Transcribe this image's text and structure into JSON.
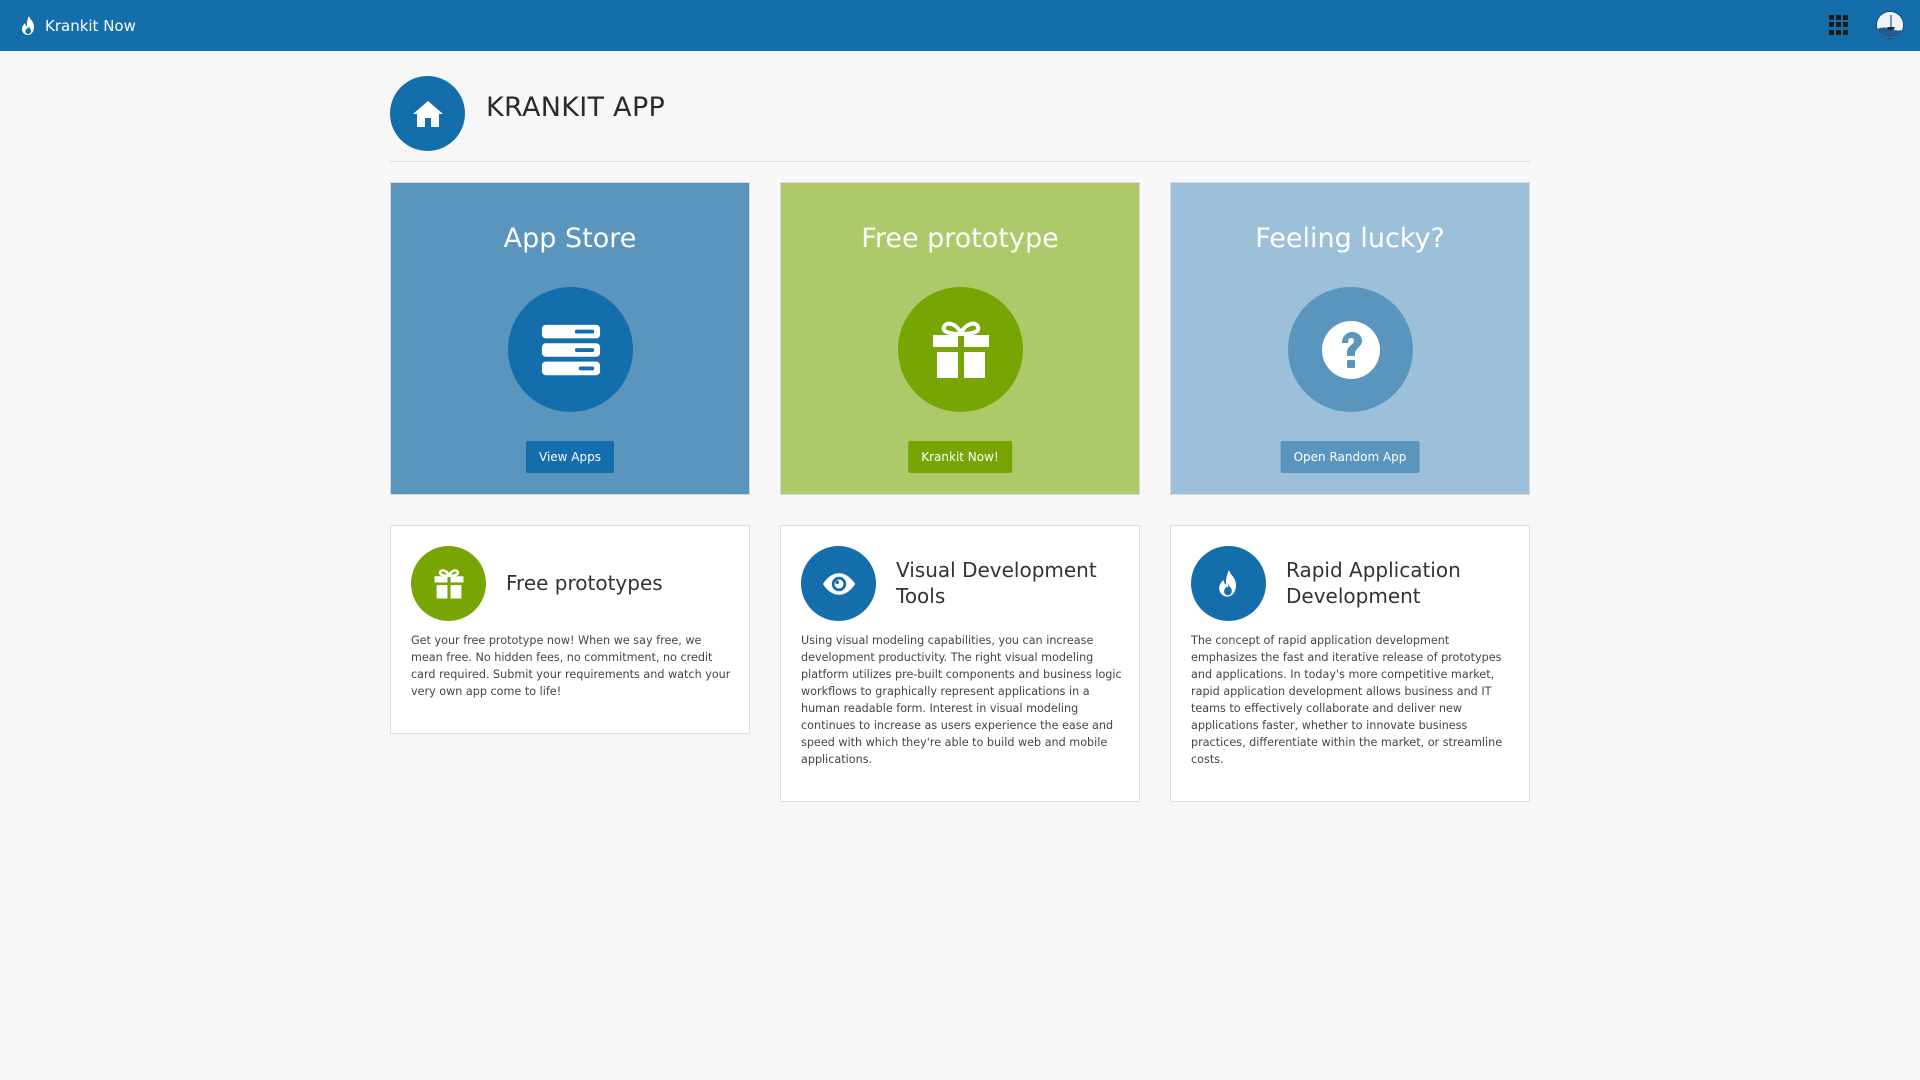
{
  "navbar": {
    "brand_label": "Krankit Now",
    "apps_icon": "apps-grid-icon",
    "avatar_icon": "user-avatar",
    "bg_color": "#146eac"
  },
  "header": {
    "title": "KRANKIT APP",
    "icon": "home-icon"
  },
  "hero_cards": [
    {
      "title": "App Store",
      "icon": "server-stack-icon",
      "button_label": "View Apps",
      "bg_color": "#5a95be",
      "accent_color": "#146eac"
    },
    {
      "title": "Free prototype",
      "icon": "gift-icon",
      "button_label": "Krankit Now!",
      "bg_color": "#aec96a",
      "accent_color": "#77a503"
    },
    {
      "title": "Feeling lucky?",
      "icon": "question-icon",
      "button_label": "Open Random App",
      "bg_color": "#9dc0da",
      "accent_color": "#5a95be"
    }
  ],
  "info_cards": [
    {
      "title": "Free prototypes",
      "icon": "gift-icon",
      "text": "Get your free prototype now! When we say free, we mean free. No hidden fees, no commitment, no credit card required. Submit your requirements and watch your very own app come to life!"
    },
    {
      "title": "Visual Development Tools",
      "icon": "eye-icon",
      "text": "Using visual modeling capabilities, you can increase development productivity. The right visual modeling platform utilizes pre-built components and business logic workflows to graphically represent applications in a human readable form. Interest in visual modeling continues to increase as users experience the ease and speed with which they're able to build web and mobile applications."
    },
    {
      "title": "Rapid Application Development",
      "icon": "flame-icon",
      "text": "The concept of rapid application development emphasizes the fast and iterative release of prototypes and applications. In today's more competitive market, rapid application development allows business and IT teams to effectively collaborate and deliver new applications faster, whether to innovate business practices, differentiate within the market, or streamline costs."
    }
  ]
}
